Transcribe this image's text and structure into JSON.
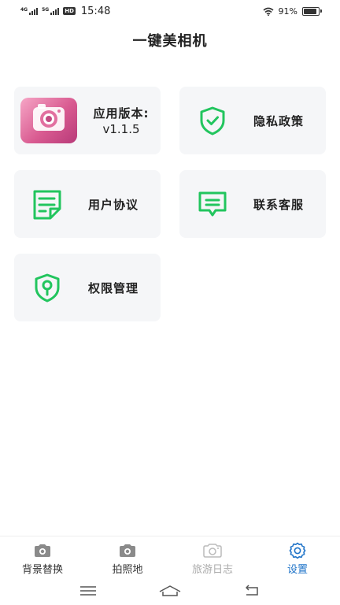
{
  "status_bar": {
    "net1": "4G",
    "net2": "5G",
    "hd": "HD",
    "time": "15:48",
    "battery_text": "91%",
    "battery_level": 0.91
  },
  "app": {
    "title": "一键美相机"
  },
  "cards": {
    "version": {
      "label": "应用版本:",
      "value": "v1.1.5"
    },
    "privacy": {
      "label": "隐私政策",
      "icon": "shield-check-icon"
    },
    "agreement": {
      "label": "用户协议",
      "icon": "document-icon"
    },
    "contact": {
      "label": "联系客服",
      "icon": "chat-bubble-icon"
    },
    "permission": {
      "label": "权限管理",
      "icon": "shield-key-icon"
    }
  },
  "bottom_nav": {
    "items": [
      {
        "label": "背景替换",
        "icon": "camera-icon"
      },
      {
        "label": "拍照地",
        "icon": "camera-icon"
      },
      {
        "label": "旅游日志",
        "icon": "camera-outline-icon"
      },
      {
        "label": "设置",
        "icon": "gear-icon"
      }
    ],
    "active_index": 3
  },
  "colors": {
    "accent_green": "#22c55e",
    "active_blue": "#1e73c8",
    "card_bg": "#f5f6f8"
  }
}
